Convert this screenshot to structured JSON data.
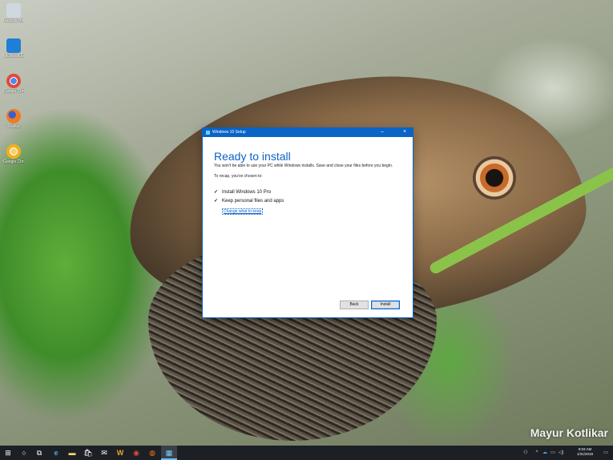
{
  "desktop": {
    "icons": [
      {
        "label": "Recycle Bin",
        "icon": "recycle-bin-icon",
        "color": "#cfd8e0"
      },
      {
        "label": "Microsoft Edge",
        "icon": "edge-icon",
        "color": "#1e7fd6"
      },
      {
        "label": "Google Chrome",
        "icon": "chrome-icon",
        "color": "#e04a3a"
      },
      {
        "label": "Firefox",
        "icon": "firefox-icon",
        "color": "#f07b21"
      },
      {
        "label": "Google Chro...",
        "icon": "chrome-canary-icon",
        "color": "#f2b01e"
      }
    ],
    "watermark": "Mayur Kotlikar"
  },
  "dialog": {
    "title": "Windows 10 Setup",
    "minimize": "–",
    "close": "×",
    "heading": "Ready to install",
    "description": "You won't be able to use your PC while Windows installs. Save and close your files before you begin.",
    "recap": "To recap, you've chosen to:",
    "items": [
      {
        "check": "✓",
        "label": "Install Windows 10 Pro"
      },
      {
        "check": "✓",
        "label": "Keep personal files and apps"
      }
    ],
    "change_link": "Change what to keep",
    "back_button": "Back",
    "install_button": "Install",
    "accent": "#0a63c6"
  },
  "taskbar": {
    "background": "#1c2024",
    "items": [
      {
        "icon": "windows-start-icon",
        "glyph": "⊞"
      },
      {
        "icon": "cortana-icon",
        "glyph": "○"
      },
      {
        "icon": "task-view-icon",
        "glyph": "⧉"
      },
      {
        "icon": "edge-icon",
        "glyph": "e"
      },
      {
        "icon": "file-explorer-icon",
        "glyph": "▬"
      },
      {
        "icon": "store-icon",
        "glyph": "🛍"
      },
      {
        "icon": "mail-icon",
        "glyph": "✉"
      },
      {
        "icon": "winamp-icon",
        "glyph": "W"
      },
      {
        "icon": "chrome-icon",
        "glyph": "◉"
      },
      {
        "icon": "firefox-icon",
        "glyph": "◍"
      },
      {
        "icon": "windows-setup-icon",
        "glyph": "▦"
      }
    ],
    "clock_time": "9:03 AM",
    "clock_date": "1/31/2019"
  }
}
